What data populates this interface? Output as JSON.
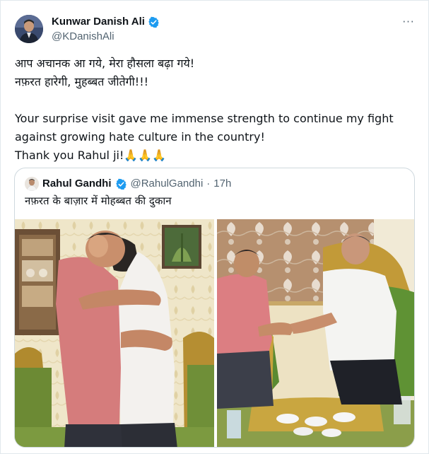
{
  "author": {
    "display_name": "Kunwar Danish Ali",
    "handle": "@KDanishAli",
    "avatar_icon": "profile-photo-icon",
    "verified_icon": "verified-badge-icon",
    "more_icon": "more-options-icon",
    "more_glyph": "···"
  },
  "tweet": {
    "line1": "आप अचानक आ गये, मेरा हौसला बढ़ा गये!",
    "line2": "नफ़रत हारेगी, मुहब्बत जीतेगी!!!",
    "line3": "Your surprise visit gave me immense strength to continue my fight",
    "line4": "against growing hate culture in the country!",
    "line5_text": "Thank you Rahul ji!",
    "line5_emoji": "🙏🙏🙏"
  },
  "quoted": {
    "display_name": "Rahul Gandhi",
    "handle": "@RahulGandhi",
    "separator": "·",
    "time": "17h",
    "text": "नफ़रत के बाज़ार में मोहब्बत की दुकान",
    "photos": [
      "hug-photo",
      "handshake-photo"
    ]
  },
  "colors": {
    "text": "#0f1419",
    "secondary": "#536471",
    "verified_blue": "#1d9bf0",
    "border": "#cfd9de"
  }
}
